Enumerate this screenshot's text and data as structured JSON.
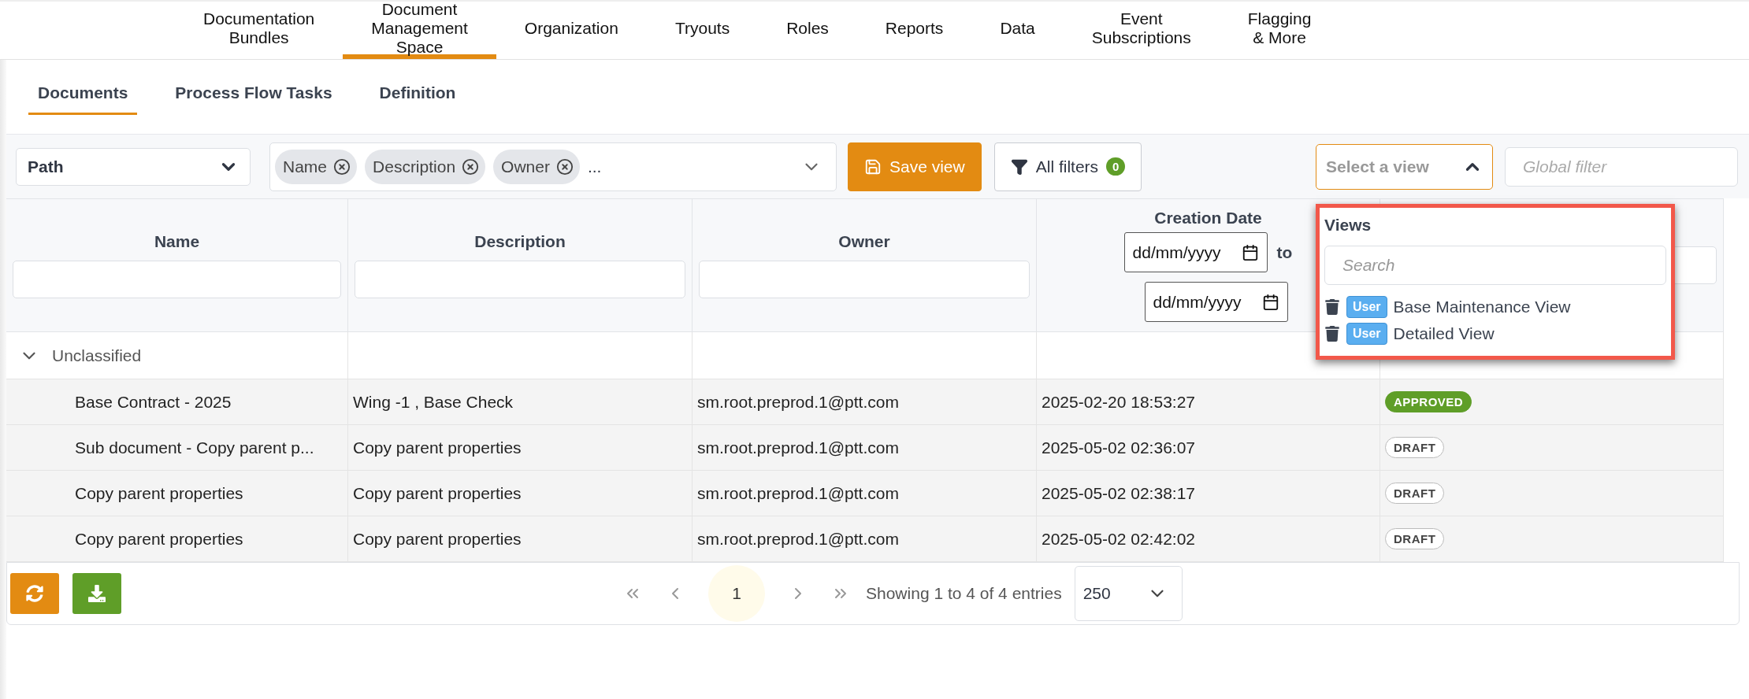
{
  "top_nav": [
    {
      "label": "Documentation\nBundles",
      "selected": false
    },
    {
      "label": "Document\nManagement\nSpace",
      "selected": true
    },
    {
      "label": "Organization",
      "selected": false
    },
    {
      "label": "Tryouts",
      "selected": false
    },
    {
      "label": "Roles",
      "selected": false
    },
    {
      "label": "Reports",
      "selected": false
    },
    {
      "label": "Data",
      "selected": false
    },
    {
      "label": "Event\nSubscriptions",
      "selected": false
    },
    {
      "label": "Flagging\n& More",
      "selected": false
    }
  ],
  "sub_tabs": [
    {
      "label": "Documents",
      "selected": true
    },
    {
      "label": "Process Flow Tasks",
      "selected": false
    },
    {
      "label": "Definition",
      "selected": false
    }
  ],
  "toolbar": {
    "group_select": {
      "value": "Path"
    },
    "column_chips": [
      "Name",
      "Description",
      "Owner"
    ],
    "chips_overflow": "...",
    "save_button": "Save view",
    "filters_button": {
      "label": "All filters",
      "count": "0"
    },
    "view_select": {
      "placeholder": "Select a view",
      "expanded": true
    },
    "global_filter": {
      "placeholder": "Global filter"
    }
  },
  "views_dropdown": {
    "title": "Views",
    "search_placeholder": "Search",
    "items": [
      {
        "tag": "User",
        "name": "Base Maintenance View"
      },
      {
        "tag": "User",
        "name": "Detailed View"
      }
    ]
  },
  "table": {
    "columns": [
      {
        "kind": "text",
        "title": "Name"
      },
      {
        "kind": "text",
        "title": "Description"
      },
      {
        "kind": "text",
        "title": "Owner"
      },
      {
        "kind": "date_range",
        "title": "Creation Date",
        "from_placeholder": "dd/mm/yyyy",
        "separator": "to",
        "to_placeholder": "dd/mm/yyyy"
      },
      {
        "kind": "text"
      }
    ],
    "group": {
      "label": "Unclassified",
      "expanded": true
    },
    "rows": [
      {
        "name": "Base Contract - 2025",
        "description": "Wing -1 , Base Check",
        "owner": "sm.root.preprod.1@ptt.com",
        "created": "2025-02-20 18:53:27",
        "status": {
          "label": "APPROVED",
          "kind": "approved"
        }
      },
      {
        "name": "Sub document - Copy parent p...",
        "description": "Copy parent properties",
        "owner": "sm.root.preprod.1@ptt.com",
        "created": "2025-05-02 02:36:07",
        "status": {
          "label": "DRAFT",
          "kind": "draft"
        }
      },
      {
        "name": "Copy parent properties",
        "description": "Copy parent properties",
        "owner": "sm.root.preprod.1@ptt.com",
        "created": "2025-05-02 02:38:17",
        "status": {
          "label": "DRAFT",
          "kind": "draft"
        }
      },
      {
        "name": "Copy parent properties",
        "description": "Copy parent properties",
        "owner": "sm.root.preprod.1@ptt.com",
        "created": "2025-05-02 02:42:02",
        "status": {
          "label": "DRAFT",
          "kind": "draft"
        }
      }
    ]
  },
  "footer": {
    "current_page": "1",
    "summary": "Showing 1 to 4 of 4 entries",
    "page_size": "250"
  }
}
